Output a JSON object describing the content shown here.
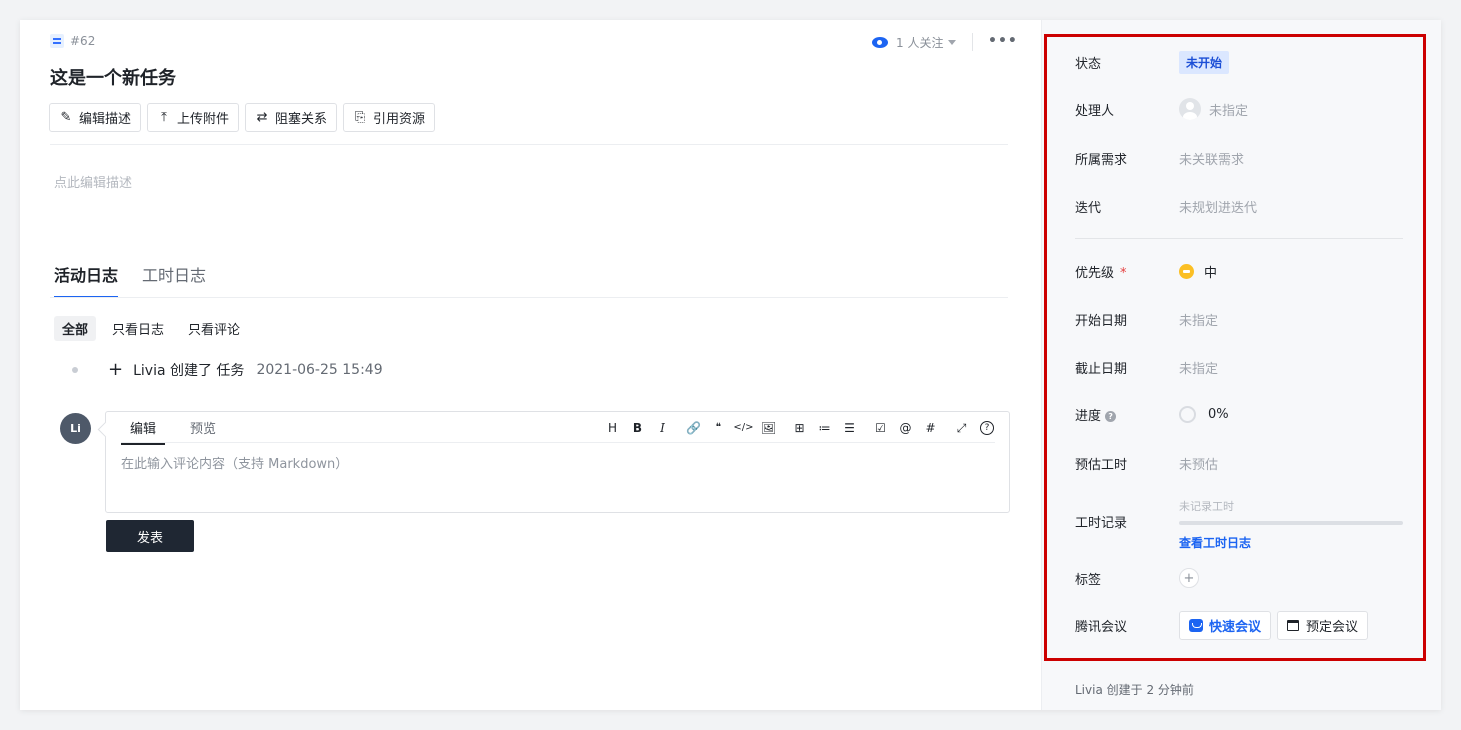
{
  "header": {
    "task_id": "#62",
    "title": "这是一个新任务",
    "watchers": "1 人关注",
    "more": "•••"
  },
  "toolbar": {
    "edit_desc": "编辑描述",
    "upload": "上传附件",
    "block": "阻塞关系",
    "ref": "引用资源"
  },
  "description": {
    "placeholder": "点此编辑描述"
  },
  "tabs": {
    "activity": "活动日志",
    "worklog": "工时日志"
  },
  "filters": {
    "all": "全部",
    "logs_only": "只看日志",
    "comments_only": "只看评论"
  },
  "activity": {
    "actor_text": "Livia 创建了 任务",
    "time": "2021-06-25 15:49"
  },
  "comment": {
    "avatar": "Li",
    "tab_edit": "编辑",
    "tab_preview": "预览",
    "placeholder": "在此输入评论内容（支持 Markdown）",
    "submit": "发表"
  },
  "editor_tools": {
    "heading": "H",
    "bold": "B",
    "italic": "I",
    "link": "🔗",
    "quote": "❝",
    "code": "</>",
    "image": "🖼",
    "table": "⊞",
    "ordered_list": "≔",
    "bullet_list": "☰",
    "task": "☑",
    "mention": "@",
    "hash": "#",
    "fullscreen": "⤢",
    "help": "?"
  },
  "sidebar": {
    "status_label": "状态",
    "status_value": "未开始",
    "assignee_label": "处理人",
    "assignee_value": "未指定",
    "requirement_label": "所属需求",
    "requirement_value": "未关联需求",
    "iteration_label": "迭代",
    "iteration_value": "未规划进迭代",
    "priority_label": "优先级",
    "priority_required": "*",
    "priority_value": "中",
    "start_label": "开始日期",
    "start_value": "未指定",
    "due_label": "截止日期",
    "due_value": "未指定",
    "progress_label": "进度",
    "progress_value": "0%",
    "estimate_label": "预估工时",
    "estimate_value": "未预估",
    "worklog_label": "工时记录",
    "worklog_placeholder": "未记录工时",
    "worklog_link": "查看工时日志",
    "tags_label": "标签",
    "meeting_label": "腾讯会议",
    "quick_meeting": "快速会议",
    "schedule_meeting": "预定会议",
    "created_note": "Livia 创建于 2 分钟前"
  },
  "colors": {
    "accent": "#1c64f2",
    "highlight_border": "#cc0000",
    "priority_medium": "#fbbf24",
    "submit_bg": "#1f2733"
  }
}
